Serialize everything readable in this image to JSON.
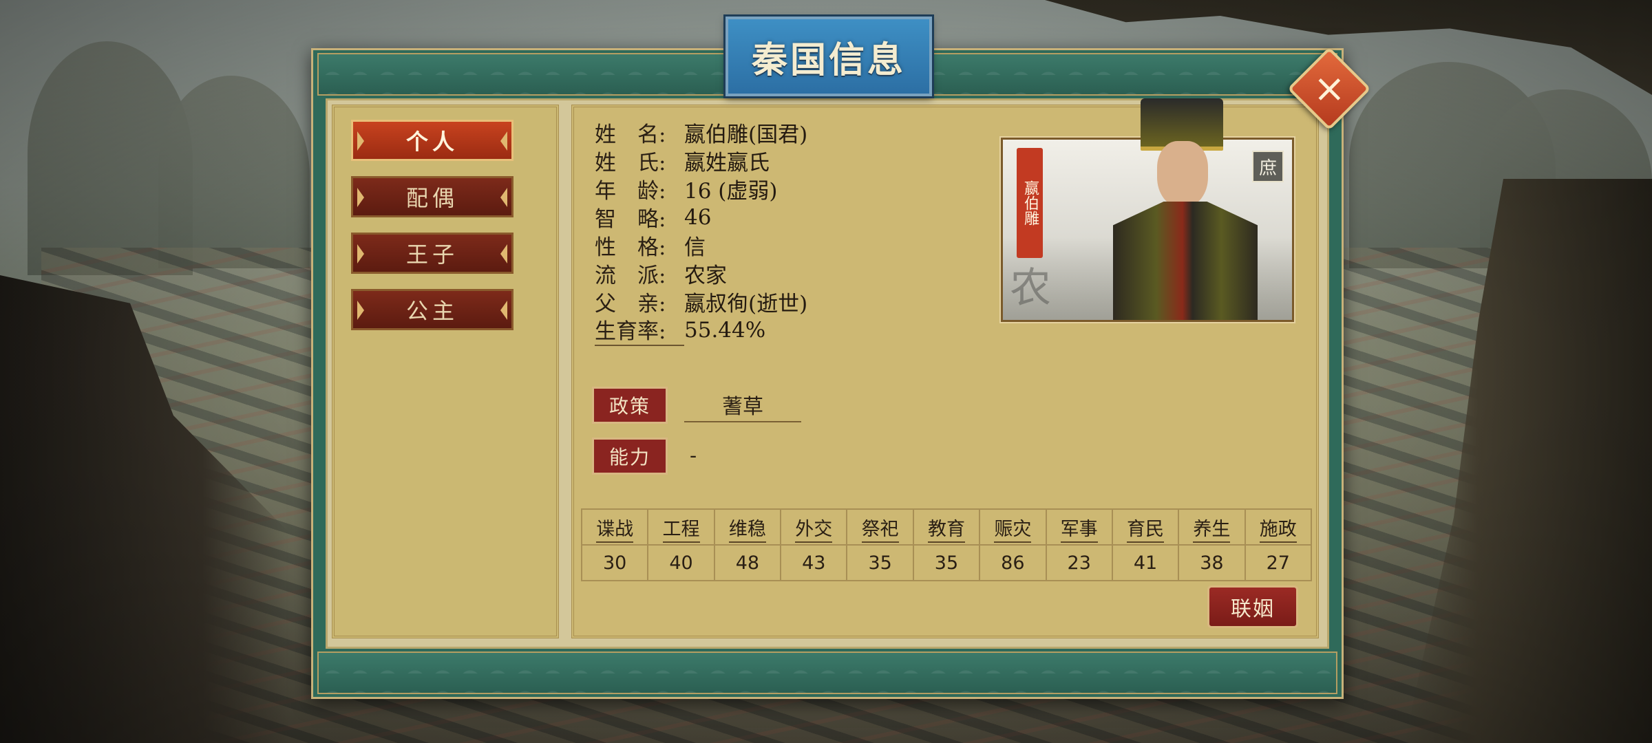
{
  "dialog": {
    "title": "秦国信息",
    "close_icon": "close-x-icon"
  },
  "tabs": [
    {
      "label": "个人",
      "active": true
    },
    {
      "label": "配偶",
      "active": false
    },
    {
      "label": "王子",
      "active": false
    },
    {
      "label": "公主",
      "active": false
    }
  ],
  "info": [
    {
      "label": "姓　名:",
      "value": "嬴伯雕(国君)"
    },
    {
      "label": "姓　氏:",
      "value": "嬴姓嬴氏"
    },
    {
      "label": "年　龄:",
      "value": "16 (虚弱)"
    },
    {
      "label": "智　略:",
      "value": "46"
    },
    {
      "label": "性　格:",
      "value": "信"
    },
    {
      "label": "流　派:",
      "value": "农家"
    },
    {
      "label": "父　亲:",
      "value": "嬴叔徇(逝世)"
    },
    {
      "label": "生育率:",
      "value": "55.44%"
    }
  ],
  "portrait": {
    "name_stamp": "嬴伯雕",
    "rank_badge": "庶",
    "school_mark": "农"
  },
  "policy": {
    "label": "政策",
    "value": "蓍草"
  },
  "ability": {
    "label": "能力",
    "value": "-"
  },
  "stats": {
    "headers": [
      "谍战",
      "工程",
      "维稳",
      "外交",
      "祭祀",
      "教育",
      "赈灾",
      "军事",
      "育民",
      "养生",
      "施政"
    ],
    "values": [
      "30",
      "40",
      "48",
      "43",
      "35",
      "35",
      "86",
      "23",
      "41",
      "38",
      "27"
    ]
  },
  "marry_button": "联姻",
  "colors": {
    "frame_green": "#2f6a5a",
    "title_blue": "#3e8fc4",
    "tab_active": "#c8431f",
    "tab_inactive": "#7d2a1a",
    "parchment": "#cdb873",
    "close_orange": "#e36a3c"
  }
}
